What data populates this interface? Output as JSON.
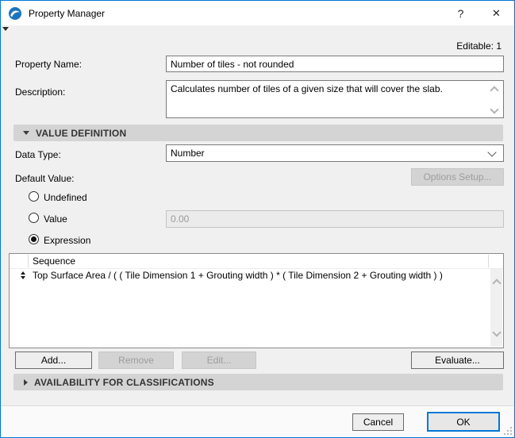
{
  "window": {
    "title": "Property Manager",
    "help_glyph": "?",
    "close_glyph": "✕",
    "editable_status": "Editable: 1"
  },
  "fields": {
    "property_name": {
      "label": "Property Name:",
      "value": "Number of tiles - not rounded"
    },
    "description": {
      "label": "Description:",
      "value": "Calculates number of tiles of a given size that will cover the slab."
    }
  },
  "value_definition": {
    "header": "VALUE DEFINITION",
    "data_type": {
      "label": "Data Type:",
      "value": "Number"
    },
    "default_value": {
      "label": "Default Value:",
      "options_setup_label": "Options Setup..."
    },
    "radios": [
      {
        "label": "Undefined",
        "selected": false
      },
      {
        "label": "Value",
        "selected": false,
        "field_value": "0.00"
      },
      {
        "label": "Expression",
        "selected": true
      }
    ],
    "sequence_list": {
      "column_header": "Sequence",
      "rows": [
        "Top Surface Area / ( ( Tile Dimension 1 + Grouting width ) * ( Tile Dimension 2 + Grouting width ) )"
      ]
    },
    "buttons": {
      "add": "Add...",
      "remove": "Remove",
      "edit": "Edit...",
      "evaluate": "Evaluate..."
    }
  },
  "classifications": {
    "header": "AVAILABILITY FOR CLASSIFICATIONS"
  },
  "footer": {
    "cancel": "Cancel",
    "ok": "OK"
  },
  "colors": {
    "accent": "#0078d7",
    "titlebar_bg": "#ffffff",
    "dialog_bg": "#f0f0f0",
    "section_bar_bg": "#d4d4d4",
    "disabled_text": "#9d9d9d"
  }
}
